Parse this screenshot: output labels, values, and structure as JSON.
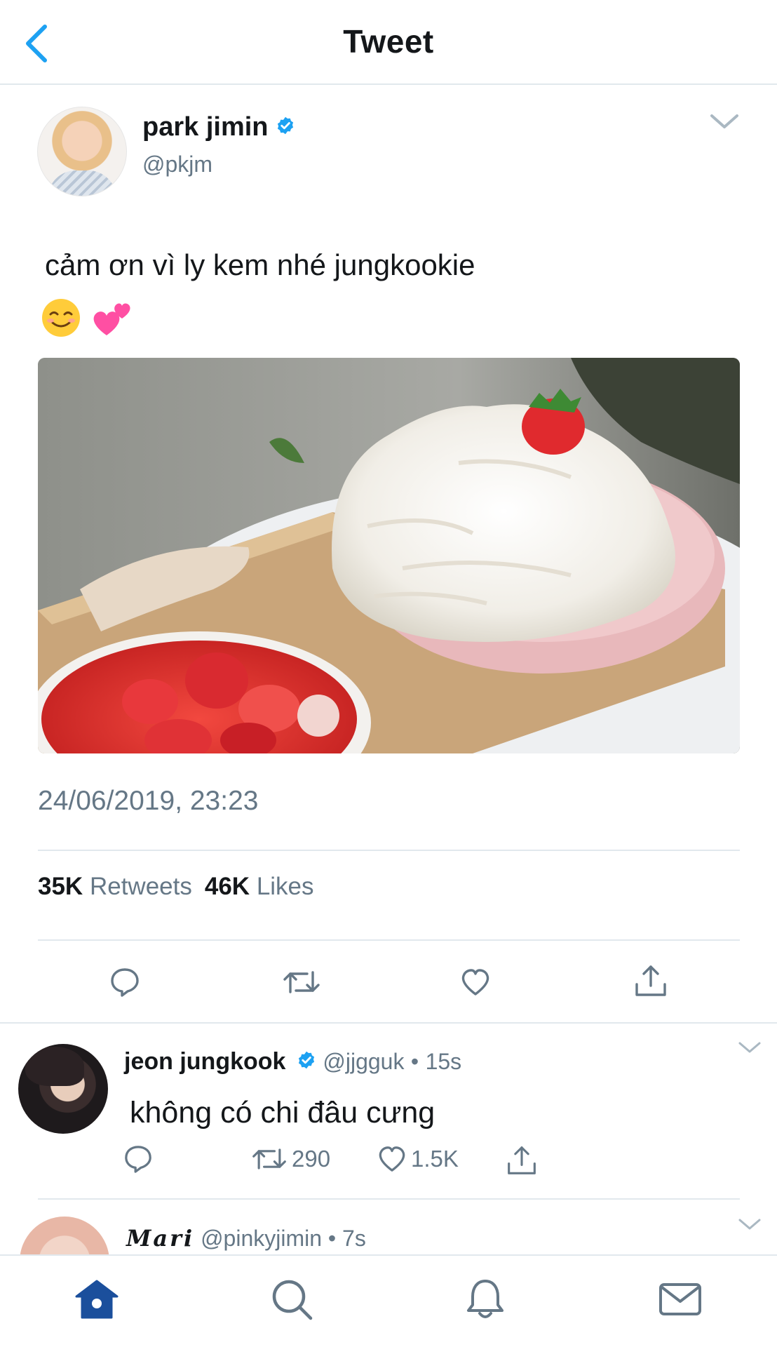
{
  "topbar": {
    "title": "Tweet"
  },
  "tweet": {
    "author_name": "park jimin",
    "author_handle": "@pkjm",
    "text": "cảm ơn vì ly kem nhé jungkookie",
    "emojis": [
      "smiling-face-icon",
      "two-hearts-icon"
    ],
    "timestamp": "24/06/2019, 23:23",
    "retweet_count": "35K",
    "retweet_label": "Retweets",
    "like_count": "46K",
    "like_label": "Likes"
  },
  "reply": {
    "author_name": "jeon jungkook",
    "author_handle": "@jjgguk",
    "time": "15s",
    "separator": "•",
    "text": "không có chi đâu cưng",
    "retweet_count": "290",
    "like_count": "1.5K"
  },
  "third_tweet": {
    "author_name": "Mari",
    "author_handle": "@pinkyjimin",
    "time": "7s",
    "separator": "•"
  },
  "colors": {
    "accent": "#1da1f2",
    "text_primary": "#14171a",
    "text_secondary": "#657786",
    "divider": "#e1e8ed",
    "home_active": "#1b4f9c"
  },
  "tabbar": {
    "tabs": [
      "home-icon",
      "search-icon",
      "notifications-icon",
      "messages-icon"
    ]
  }
}
